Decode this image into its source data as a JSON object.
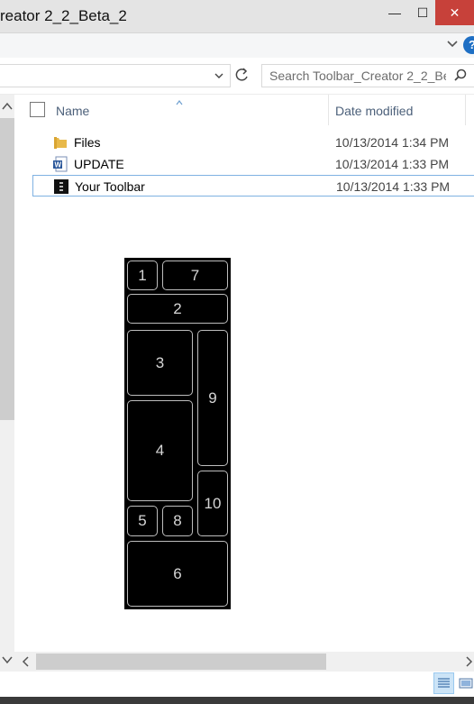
{
  "window": {
    "title": "reator 2_2_Beta_2",
    "minimize_glyph": "—",
    "maximize_glyph": "☐",
    "close_glyph": "✕"
  },
  "ribbon": {
    "help_glyph": "?"
  },
  "search": {
    "placeholder": "Search Toolbar_Creator 2_2_Be..."
  },
  "columns": {
    "name": "Name",
    "date_modified": "Date modified"
  },
  "files": [
    {
      "name": "Files",
      "date": "10/13/2014 1:34 PM",
      "icon": "folder-icon",
      "selected": false
    },
    {
      "name": "UPDATE",
      "date": "10/13/2014 1:33 PM",
      "icon": "word-document-icon",
      "selected": false
    },
    {
      "name": "Your Toolbar",
      "date": "10/13/2014 1:33 PM",
      "icon": "toolbar-app-icon",
      "selected": true
    }
  ],
  "preview": {
    "tiles": [
      "1",
      "7",
      "2",
      "3",
      "9",
      "4",
      "10",
      "5",
      "8",
      "6"
    ]
  },
  "colors": {
    "close_button": "#c7413a",
    "selection_border": "#7fb2e2",
    "column_header_text": "#4c607a",
    "help_icon": "#1e6fc4",
    "preview_background": "#000000"
  }
}
